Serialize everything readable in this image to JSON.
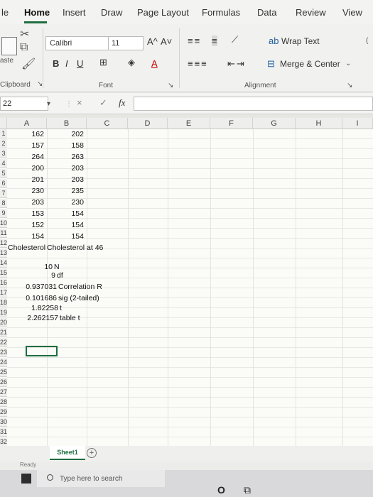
{
  "ribbon_tabs": [
    "le",
    "Home",
    "Insert",
    "Draw",
    "Page Layout",
    "Formulas",
    "Data",
    "Review",
    "View"
  ],
  "ribbon": {
    "paste_label": "aste",
    "clipboard_label": "Clipboard",
    "font_name": "Calibri",
    "font_size": "11",
    "grow_font": "A^",
    "shrink_font": "A˅",
    "bold": "B",
    "italic": "I",
    "underline": "U",
    "font_color_letter": "A",
    "font_group_label": "Font",
    "wrap_text": "Wrap Text",
    "merge_center": "Merge & Center",
    "alignment_label": "Alignment"
  },
  "formula_bar": {
    "name_box": "22",
    "fx_label": "fx",
    "cancel": "×",
    "enter": "✓",
    "value": ""
  },
  "columns": [
    "A",
    "B",
    "C",
    "D",
    "E",
    "F",
    "G",
    "H",
    "I"
  ],
  "rows": [
    "1",
    "2",
    "3",
    "4",
    "5",
    "6",
    "7",
    "8",
    "9",
    "10",
    "11",
    "12",
    "13",
    "14",
    "15",
    "16",
    "17",
    "18",
    "19",
    "20",
    "21",
    "22",
    "23",
    "24",
    "25",
    "26",
    "27",
    "28",
    "29",
    "30",
    "31",
    "32"
  ],
  "cells": {
    "a1": "162",
    "b1": "202",
    "a2": "157",
    "b2": "158",
    "a3": "264",
    "b3": "263",
    "a4": "200",
    "b4": "203",
    "a5": "201",
    "b5": "203",
    "a6": "230",
    "b6": "235",
    "a7": "203",
    "b7": "230",
    "a8": "153",
    "b8": "154",
    "a9": "152",
    "b9": "154",
    "a10": "154",
    "b10": "154",
    "a11": "Cholesterol",
    "b11": "Cholesterol at 46",
    "a13": "10",
    "b13": "N",
    "a14": "9",
    "b14": "df",
    "a15": "0.937031",
    "b15": "Correlation R",
    "a16": "0.101686",
    "b16": "sig (2-tailed)",
    "a17": "1.82258",
    "b17": "t",
    "a18": "2.262157",
    "b18": "table t"
  },
  "sheet_tab": "Sheet1",
  "add_sheet": "+",
  "status_text": "Ready",
  "taskbar": {
    "search_placeholder": "Type here to search"
  },
  "colors": {
    "excel_green": "#1e6d3f",
    "ribbon_bg": "#f1f1ef"
  }
}
